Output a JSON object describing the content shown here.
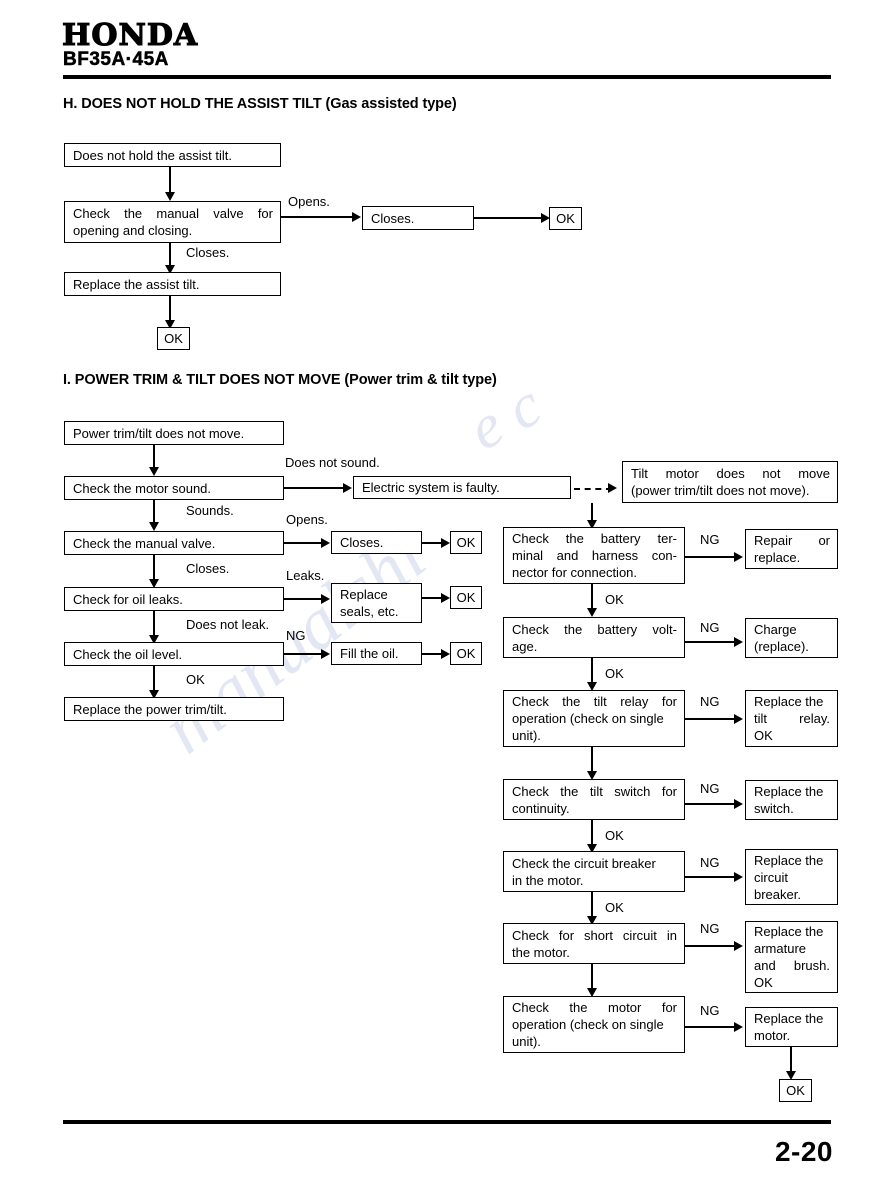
{
  "header": {
    "brand": "HONDA",
    "model": "BF35A·45A",
    "page_number": "2-20"
  },
  "watermark": {
    "text_a": "e c",
    "text_b": "manualshi"
  },
  "sections": [
    {
      "id": "H",
      "heading": "H. DOES NOT HOLD THE ASSIST TILT (Gas assisted type)",
      "boxes": {
        "start": "Does not hold the assist tilt.",
        "check_manual_valve_l1": "Check  the  manual  valve  for",
        "check_manual_valve_l2": "opening and closing.",
        "closes": "Closes.",
        "ok_right": "OK",
        "replace_assist_tilt": "Replace the assist tilt.",
        "ok_bottom": "OK"
      },
      "labels": {
        "opens": "Opens.",
        "closes": "Closes."
      }
    },
    {
      "id": "I",
      "heading": "I. POWER TRIM & TILT DOES NOT MOVE (Power trim & tilt type)",
      "boxes": {
        "start": "Power trim/tilt does not move.",
        "check_motor_sound": "Check the motor sound.",
        "electric_system_faulty": "Electric system is faulty.",
        "tilt_motor_l1": "Tilt  motor  does  not  move",
        "tilt_motor_l2": "(power trim/tilt does not move).",
        "check_manual_valve": "Check the manual valve.",
        "closes": "Closes.",
        "ok_valve": "OK",
        "check_oil_leaks": "Check for oil leaks.",
        "replace_seals_l1": "Replace",
        "replace_seals_l2": "seals, etc.",
        "ok_seals": "OK",
        "check_oil_level": "Check the oil level.",
        "fill_oil": "Fill the oil.",
        "ok_oil": "OK",
        "replace_power_trim": "Replace the power trim/tilt.",
        "check_battery_terminal_l1": "Check   the   battery   ter-",
        "check_battery_terminal_l2": "minal   and   harness   con-",
        "check_battery_terminal_l3": "nector for connection.",
        "repair_or_replace_l1": "Repair    or",
        "repair_or_replace_l2": "replace.",
        "check_battery_voltage_l1": "Check   the   battery   volt-",
        "check_battery_voltage_l2": "age.",
        "charge_replace_l1": "Charge",
        "charge_replace_l2": "(replace).",
        "check_tilt_relay_l1": "Check  the  tilt  relay  for",
        "check_tilt_relay_l2": "operation (check on single",
        "check_tilt_relay_l3": "unit).",
        "replace_tilt_relay_l1": "Replace the",
        "replace_tilt_relay_l2": "tilt    relay.",
        "replace_tilt_relay_l3": "OK",
        "check_tilt_switch_l1": "Check  the  tilt  switch  for",
        "check_tilt_switch_l2": "continuity.",
        "replace_switch_l1": "Replace the",
        "replace_switch_l2": "switch.",
        "check_circuit_breaker_l1": "Check the circuit breaker",
        "check_circuit_breaker_l2": "in the motor.",
        "replace_breaker_l1": "Replace the",
        "replace_breaker_l2": "circuit",
        "replace_breaker_l3": "breaker.",
        "check_short_circuit_l1": "Check for short circuit in",
        "check_short_circuit_l2": "the motor.",
        "replace_armature_l1": "Replace the",
        "replace_armature_l2": "armature",
        "replace_armature_l3": "and   brush.",
        "replace_armature_l4": "OK",
        "check_motor_operation_l1": "Check   the   motor   for",
        "check_motor_operation_l2": "operation (check on single",
        "check_motor_operation_l3": "unit).",
        "replace_motor_l1": "Replace the",
        "replace_motor_l2": "motor.",
        "ok_final": "OK"
      },
      "labels": {
        "does_not_sound": "Does not sound.",
        "sounds": "Sounds.",
        "opens": "Opens.",
        "closes": "Closes.",
        "leaks": "Leaks.",
        "does_not_leak": "Does not leak.",
        "ng_oil_level": "NG",
        "ok_oil_level": "OK",
        "ng_battery_terminal": "NG",
        "ok_battery_terminal": "OK",
        "ng_battery_voltage": "NG",
        "ok_battery_voltage": "OK",
        "ng_tilt_relay": "NG",
        "ok_tilt_relay": "OK",
        "ng_tilt_switch": "NG",
        "ok_tilt_switch": "OK",
        "ng_circuit_breaker": "NG",
        "ok_circuit_breaker": "OK",
        "ng_short_circuit": "NG",
        "ng_motor_operation": "NG"
      }
    }
  ]
}
